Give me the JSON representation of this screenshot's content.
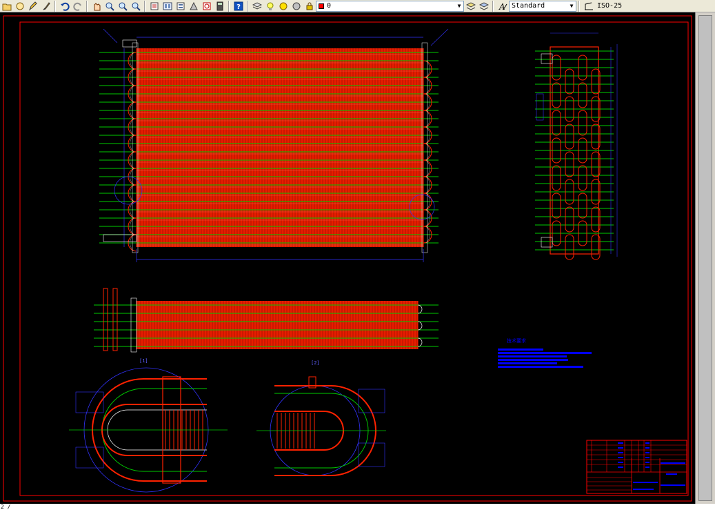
{
  "toolbar": {
    "buttons": [
      {
        "name": "open-icon"
      },
      {
        "name": "pan-icon"
      },
      {
        "name": "pencil-icon"
      },
      {
        "name": "brush-icon"
      },
      {
        "name": "undo-icon"
      },
      {
        "name": "redo-icon"
      },
      {
        "name": "pan-realtime-icon"
      },
      {
        "name": "zoom-realtime-icon"
      },
      {
        "name": "zoom-window-icon"
      },
      {
        "name": "zoom-previous-icon"
      },
      {
        "name": "properties-icon"
      },
      {
        "name": "design-center-icon"
      },
      {
        "name": "tool-palettes-icon"
      },
      {
        "name": "markup-icon"
      },
      {
        "name": "calculator-icon"
      },
      {
        "name": "help-icon"
      }
    ],
    "layer_combo_value": "0",
    "text_style_value": "Standard",
    "dim_style_value": "ISO-25"
  },
  "colors": {
    "canvas": "#000000",
    "border": "#ff0000",
    "fins": "#ff2200",
    "tubes": "#00cc00",
    "dims": "#3333ff",
    "text": "#0000ff"
  },
  "drawing": {
    "section_label_left": "[1]",
    "section_label_right": "[2]",
    "notes_title": "技术要求"
  },
  "statusbar": {
    "text": "2 /"
  }
}
